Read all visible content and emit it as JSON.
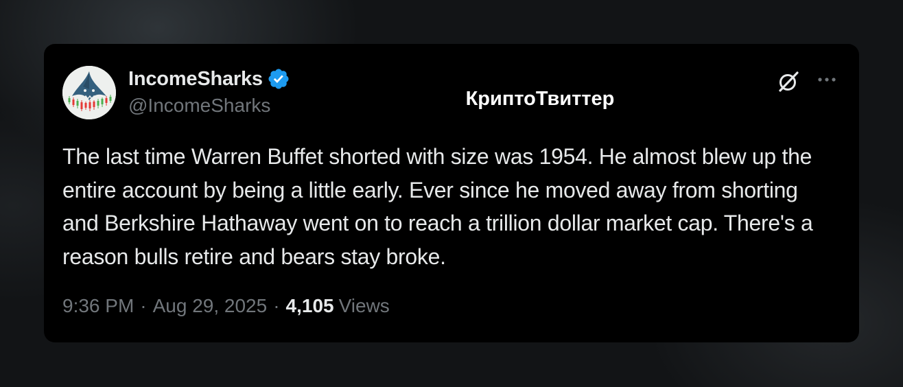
{
  "author": {
    "display_name": "IncomeSharks",
    "handle": "@IncomeSharks",
    "verified": true,
    "avatar_icon": "shark-candlestick-logo"
  },
  "watermark": "КриптоТвиттер",
  "header_icons": {
    "grok": "grok-icon",
    "more": "more-options-icon"
  },
  "tweet": {
    "text": "The last time Warren Buffet shorted with size was 1954. He almost blew up the entire account by being a little early. Ever since he moved away from shorting and Berkshire Hathaway went on to reach a trillion dollar market cap. There's a reason bulls retire and bears stay broke.",
    "time": "9:36 PM",
    "separator": "·",
    "date": "Aug 29, 2025",
    "views_count": "4,105",
    "views_label": "Views"
  },
  "colors": {
    "card_background": "#000000",
    "primary_text": "#e7e9ea",
    "secondary_text": "#71767b",
    "verified_blue": "#1d9bf0"
  }
}
